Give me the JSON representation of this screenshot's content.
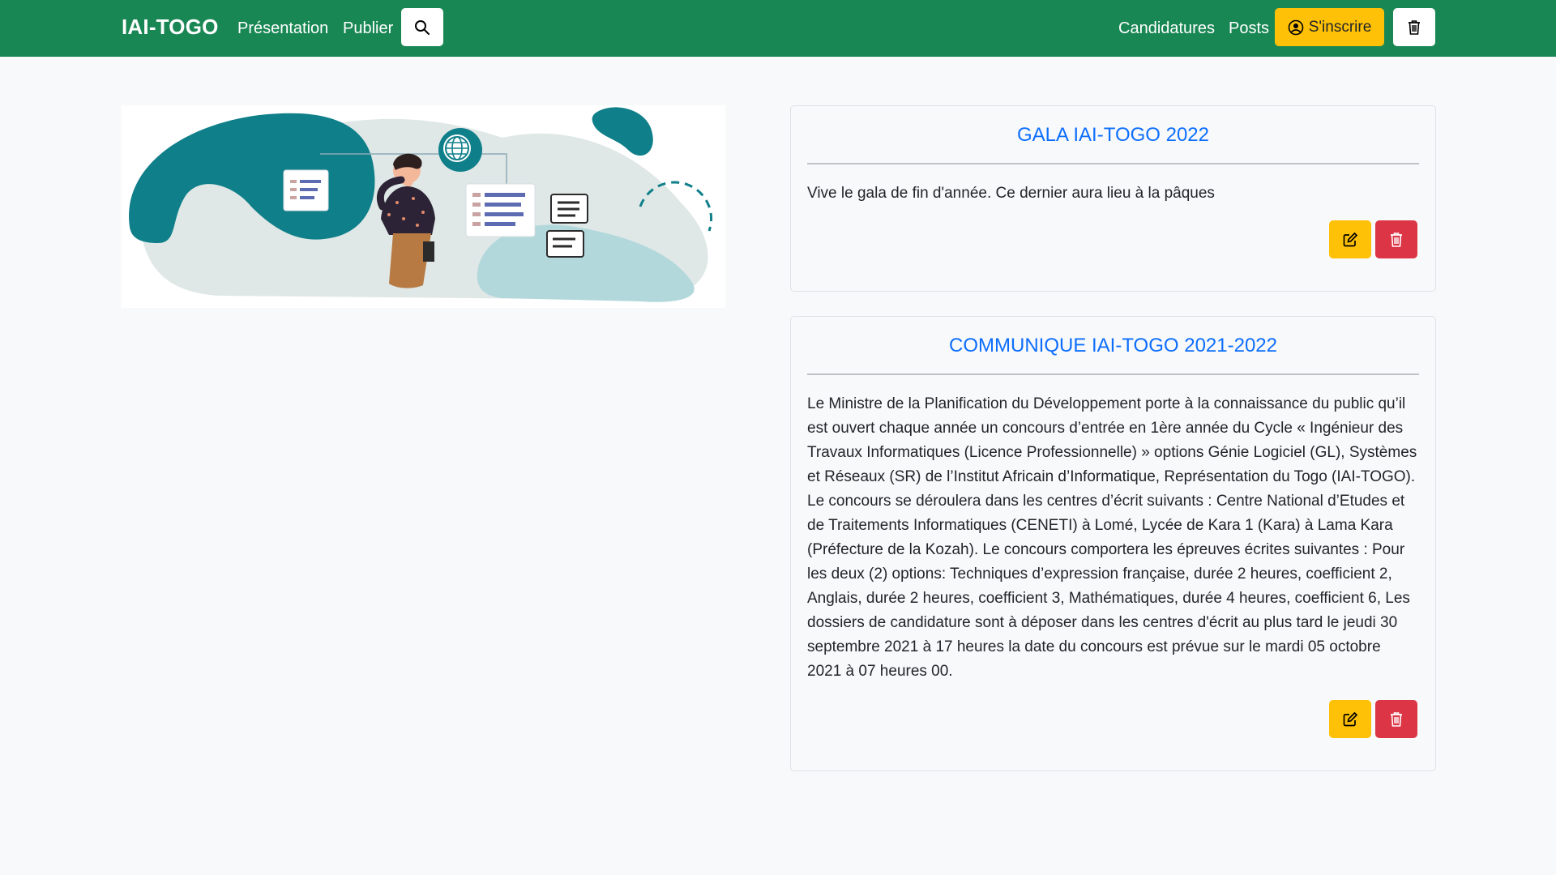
{
  "nav": {
    "brand": "IAI-TOGO",
    "links": [
      "Présentation",
      "Publier"
    ],
    "right_links": [
      "Candidatures",
      "Posts"
    ],
    "signup_label": "S'inscrire",
    "search_icon": "search-icon",
    "trash_icon": "trash-icon",
    "color": "#198754"
  },
  "hero": {
    "image": "illustration-woman-documents"
  },
  "posts": [
    {
      "title": "GALA IAI-TOGO 2022",
      "body": "Vive le gala de fin d'année. Ce dernier aura lieu à la pâques",
      "edit_icon": "edit-icon",
      "delete_icon": "trash-icon"
    },
    {
      "title": "COMMUNIQUE IAI-TOGO 2021-2022",
      "body": "Le Ministre de la Planification du Développement porte à la connaissance du public qu’il est ouvert chaque année un concours d’entrée en 1ère année du Cycle « Ingénieur des Travaux Informatiques (Licence Professionnelle) » options Génie Logiciel (GL), Systèmes et Réseaux (SR) de l’Institut Africain d’Informatique, Représentation du Togo (IAI-TOGO). Le concours se déroulera dans les centres d’écrit suivants : Centre National d’Etudes et de Traitements Informatiques (CENETI) à Lomé, Lycée de Kara 1 (Kara) à Lama Kara (Préfecture de la Kozah). Le concours comportera les épreuves écrites suivantes : Pour les deux (2) options: Techniques d’expression française, durée 2 heures, coefficient 2, Anglais, durée 2 heures, coefficient 3, Mathématiques, durée 4 heures, coefficient 6, Les dossiers de candidature sont à déposer dans les centres d'écrit au plus tard le jeudi 30 septembre 2021 à 17 heures la date du concours est prévue sur le mardi 05 octobre 2021 à 07 heures 00.",
      "edit_icon": "edit-icon",
      "delete_icon": "trash-icon"
    }
  ],
  "colors": {
    "accent": "#0d6efd",
    "warning": "#ffc107",
    "danger": "#dc3545",
    "teal": "#0f7f8a"
  }
}
